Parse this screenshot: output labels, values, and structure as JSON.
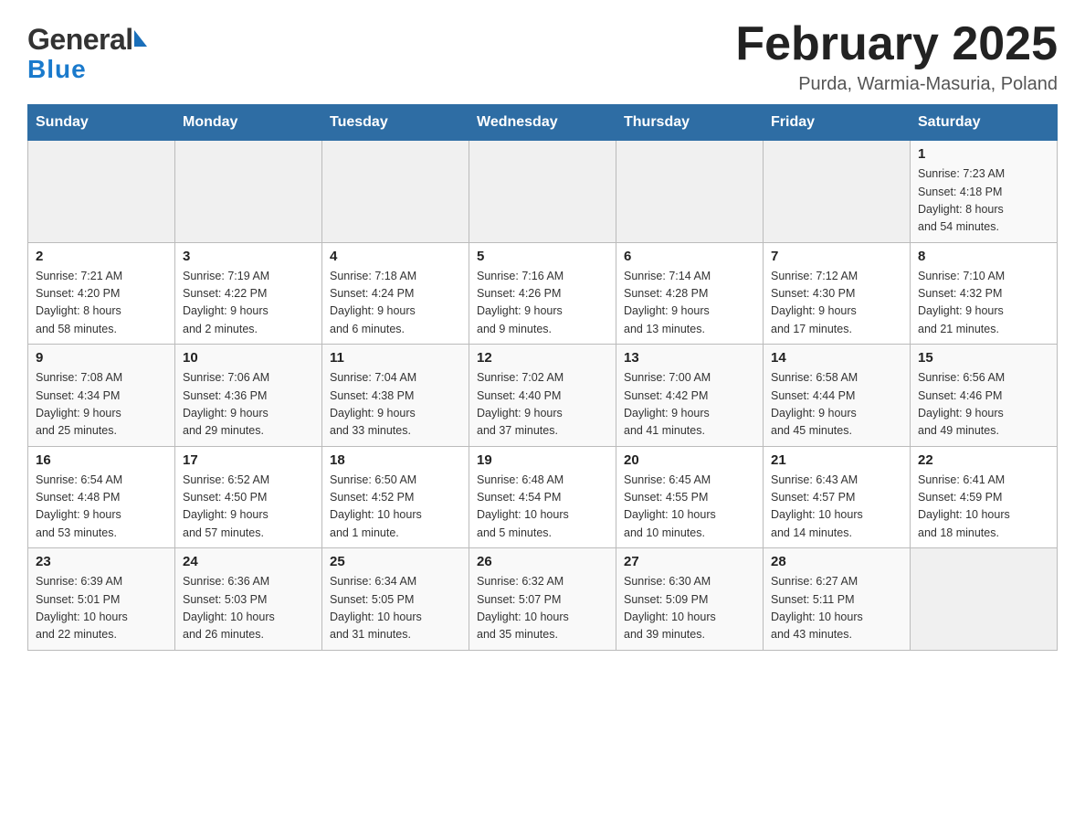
{
  "header": {
    "logo_general": "General",
    "logo_blue": "Blue",
    "title": "February 2025",
    "subtitle": "Purda, Warmia-Masuria, Poland"
  },
  "weekdays": [
    "Sunday",
    "Monday",
    "Tuesday",
    "Wednesday",
    "Thursday",
    "Friday",
    "Saturday"
  ],
  "weeks": [
    [
      {
        "day": "",
        "info": ""
      },
      {
        "day": "",
        "info": ""
      },
      {
        "day": "",
        "info": ""
      },
      {
        "day": "",
        "info": ""
      },
      {
        "day": "",
        "info": ""
      },
      {
        "day": "",
        "info": ""
      },
      {
        "day": "1",
        "info": "Sunrise: 7:23 AM\nSunset: 4:18 PM\nDaylight: 8 hours\nand 54 minutes."
      }
    ],
    [
      {
        "day": "2",
        "info": "Sunrise: 7:21 AM\nSunset: 4:20 PM\nDaylight: 8 hours\nand 58 minutes."
      },
      {
        "day": "3",
        "info": "Sunrise: 7:19 AM\nSunset: 4:22 PM\nDaylight: 9 hours\nand 2 minutes."
      },
      {
        "day": "4",
        "info": "Sunrise: 7:18 AM\nSunset: 4:24 PM\nDaylight: 9 hours\nand 6 minutes."
      },
      {
        "day": "5",
        "info": "Sunrise: 7:16 AM\nSunset: 4:26 PM\nDaylight: 9 hours\nand 9 minutes."
      },
      {
        "day": "6",
        "info": "Sunrise: 7:14 AM\nSunset: 4:28 PM\nDaylight: 9 hours\nand 13 minutes."
      },
      {
        "day": "7",
        "info": "Sunrise: 7:12 AM\nSunset: 4:30 PM\nDaylight: 9 hours\nand 17 minutes."
      },
      {
        "day": "8",
        "info": "Sunrise: 7:10 AM\nSunset: 4:32 PM\nDaylight: 9 hours\nand 21 minutes."
      }
    ],
    [
      {
        "day": "9",
        "info": "Sunrise: 7:08 AM\nSunset: 4:34 PM\nDaylight: 9 hours\nand 25 minutes."
      },
      {
        "day": "10",
        "info": "Sunrise: 7:06 AM\nSunset: 4:36 PM\nDaylight: 9 hours\nand 29 minutes."
      },
      {
        "day": "11",
        "info": "Sunrise: 7:04 AM\nSunset: 4:38 PM\nDaylight: 9 hours\nand 33 minutes."
      },
      {
        "day": "12",
        "info": "Sunrise: 7:02 AM\nSunset: 4:40 PM\nDaylight: 9 hours\nand 37 minutes."
      },
      {
        "day": "13",
        "info": "Sunrise: 7:00 AM\nSunset: 4:42 PM\nDaylight: 9 hours\nand 41 minutes."
      },
      {
        "day": "14",
        "info": "Sunrise: 6:58 AM\nSunset: 4:44 PM\nDaylight: 9 hours\nand 45 minutes."
      },
      {
        "day": "15",
        "info": "Sunrise: 6:56 AM\nSunset: 4:46 PM\nDaylight: 9 hours\nand 49 minutes."
      }
    ],
    [
      {
        "day": "16",
        "info": "Sunrise: 6:54 AM\nSunset: 4:48 PM\nDaylight: 9 hours\nand 53 minutes."
      },
      {
        "day": "17",
        "info": "Sunrise: 6:52 AM\nSunset: 4:50 PM\nDaylight: 9 hours\nand 57 minutes."
      },
      {
        "day": "18",
        "info": "Sunrise: 6:50 AM\nSunset: 4:52 PM\nDaylight: 10 hours\nand 1 minute."
      },
      {
        "day": "19",
        "info": "Sunrise: 6:48 AM\nSunset: 4:54 PM\nDaylight: 10 hours\nand 5 minutes."
      },
      {
        "day": "20",
        "info": "Sunrise: 6:45 AM\nSunset: 4:55 PM\nDaylight: 10 hours\nand 10 minutes."
      },
      {
        "day": "21",
        "info": "Sunrise: 6:43 AM\nSunset: 4:57 PM\nDaylight: 10 hours\nand 14 minutes."
      },
      {
        "day": "22",
        "info": "Sunrise: 6:41 AM\nSunset: 4:59 PM\nDaylight: 10 hours\nand 18 minutes."
      }
    ],
    [
      {
        "day": "23",
        "info": "Sunrise: 6:39 AM\nSunset: 5:01 PM\nDaylight: 10 hours\nand 22 minutes."
      },
      {
        "day": "24",
        "info": "Sunrise: 6:36 AM\nSunset: 5:03 PM\nDaylight: 10 hours\nand 26 minutes."
      },
      {
        "day": "25",
        "info": "Sunrise: 6:34 AM\nSunset: 5:05 PM\nDaylight: 10 hours\nand 31 minutes."
      },
      {
        "day": "26",
        "info": "Sunrise: 6:32 AM\nSunset: 5:07 PM\nDaylight: 10 hours\nand 35 minutes."
      },
      {
        "day": "27",
        "info": "Sunrise: 6:30 AM\nSunset: 5:09 PM\nDaylight: 10 hours\nand 39 minutes."
      },
      {
        "day": "28",
        "info": "Sunrise: 6:27 AM\nSunset: 5:11 PM\nDaylight: 10 hours\nand 43 minutes."
      },
      {
        "day": "",
        "info": ""
      }
    ]
  ]
}
